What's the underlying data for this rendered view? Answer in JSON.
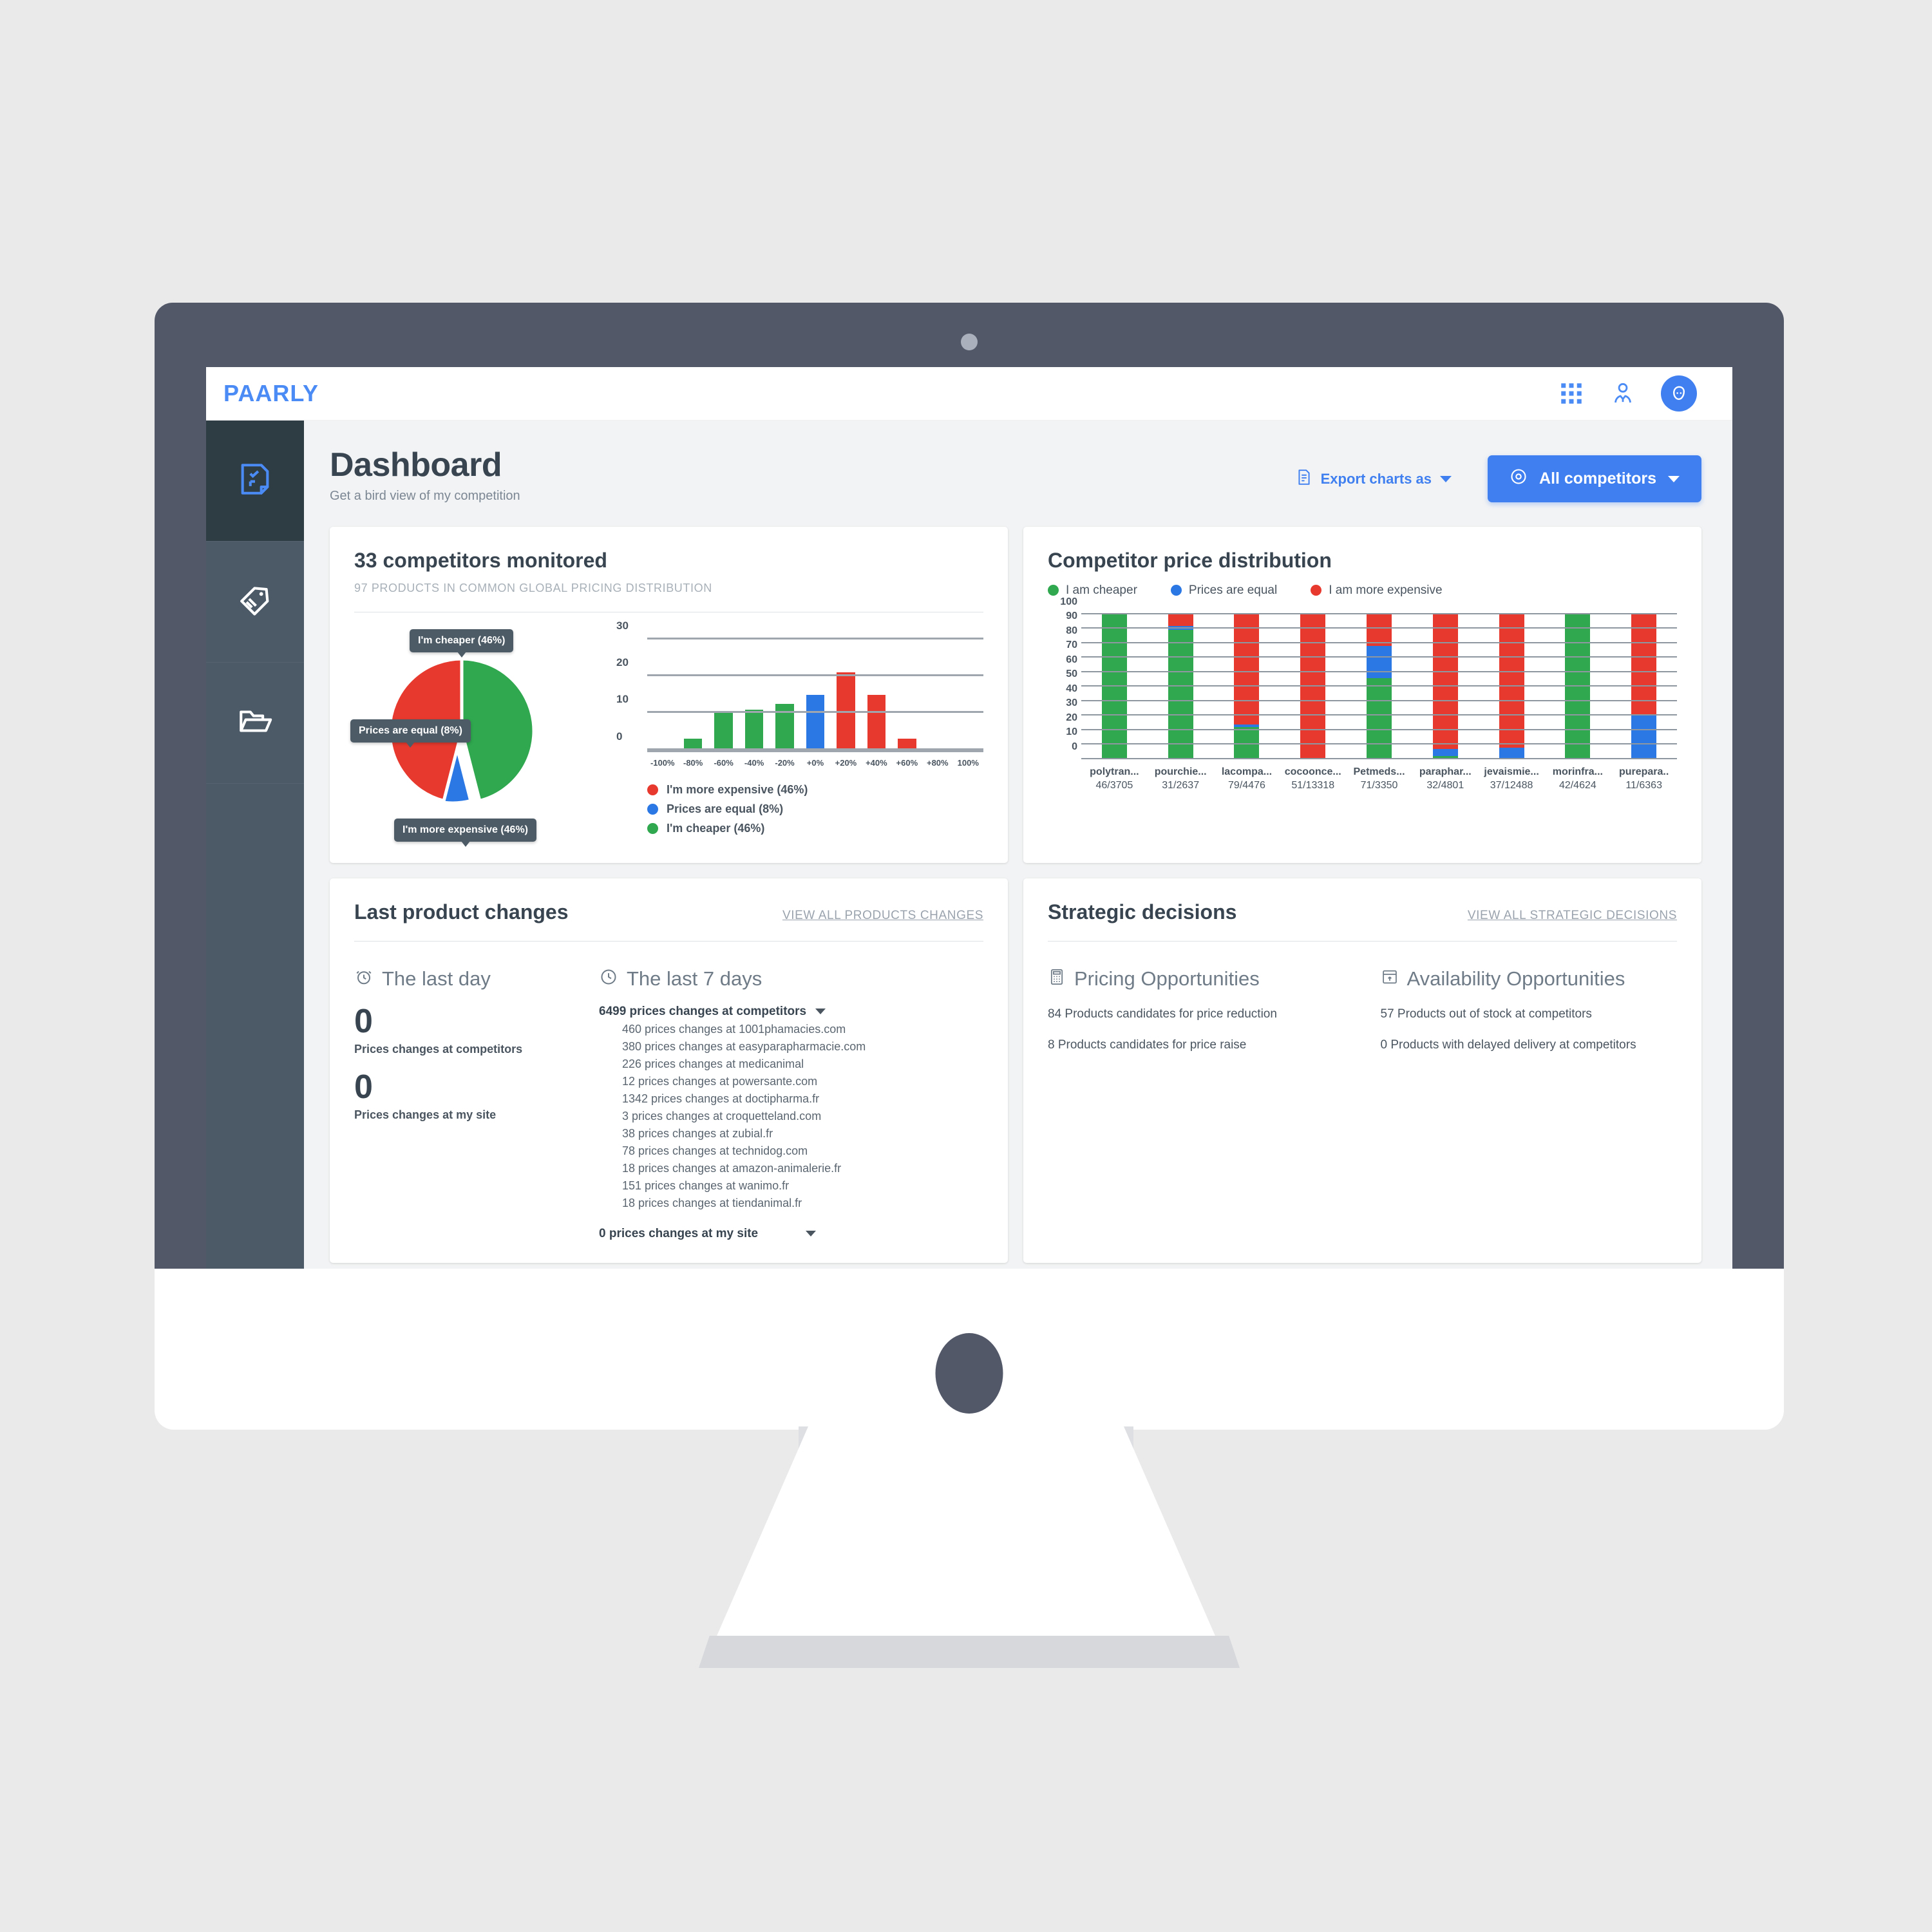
{
  "app": {
    "brand": "PAARLY",
    "topbar_icons": [
      "grid-apps-icon",
      "user-account-icon",
      "avatar-face-icon"
    ]
  },
  "sidebar": {
    "items": [
      {
        "icon": "dashboard-checklist-icon",
        "active": true
      },
      {
        "icon": "price-tag-icon",
        "active": false
      },
      {
        "icon": "folder-icon",
        "active": false
      }
    ]
  },
  "header": {
    "title": "Dashboard",
    "subtitle": "Get a bird view of my competition",
    "export_label": "Export charts as",
    "export_icon": "document-export-icon",
    "competitors_label": "All competitors",
    "competitors_icon": "eye-icon",
    "accent": "#3f7ff0"
  },
  "colors": {
    "green": "#2fa84f",
    "blue": "#2b78e4",
    "red": "#e8392e",
    "dark": "#384550",
    "muted": "#9aa3ad"
  },
  "cards": {
    "competitors": {
      "title": "33 competitors monitored",
      "subtitle": "97 PRODUCTS IN COMMON GLOBAL PRICING DISTRIBUTION"
    },
    "distribution": {
      "title": "Competitor price distribution"
    },
    "last_changes": {
      "title": "Last product changes",
      "view_all": "VIEW ALL PRODUCTS CHANGES",
      "last_day": {
        "label": "The last day",
        "icon": "alarm-clock-icon",
        "metrics": [
          {
            "value": "0",
            "caption": "Prices changes at competitors"
          },
          {
            "value": "0",
            "caption": "Prices changes at my site"
          }
        ]
      },
      "last_7_days": {
        "label": "The last 7 days",
        "icon": "clock-icon",
        "competitors_header": "6499 prices changes at competitors",
        "competitor_lines": [
          "460 prices changes at 1001phamacies.com",
          "380 prices changes at easyparapharmacie.com",
          "226 prices changes at medicanimal",
          "12 prices changes at powersante.com",
          "1342 prices changes at doctipharma.fr",
          "3 prices changes at croquetteland.com",
          "38 prices changes at zubial.fr",
          "78 prices changes at technidog.com",
          "18 prices changes at amazon-animalerie.fr",
          "151 prices changes at wanimo.fr",
          "18 prices changes at tiendanimal.fr"
        ],
        "my_site_header": "0 prices changes at my site"
      }
    },
    "strategic": {
      "title": "Strategic decisions",
      "view_all": "VIEW ALL STRATEGIC DECISIONS",
      "columns": [
        {
          "title": "Pricing Opportunities",
          "icon": "calculator-icon",
          "lines": [
            "84 Products candidates for price reduction",
            "8 Products candidates for price raise"
          ]
        },
        {
          "title": "Availability Opportunities",
          "icon": "box-upload-icon",
          "lines": [
            "57 Products out of stock at competitors",
            "0 Products with delayed delivery at competitors"
          ]
        }
      ]
    }
  },
  "chart_data": [
    {
      "type": "pie",
      "title": "Global pricing distribution",
      "labels": [
        "I'm cheaper (46%)",
        "Prices are equal (8%)",
        "I'm more expensive (46%)"
      ],
      "values": [
        46,
        8,
        46
      ],
      "colors": [
        "#2fa84f",
        "#2b78e4",
        "#e8392e"
      ],
      "legend_position": "none"
    },
    {
      "type": "bar",
      "title": "Price gap histogram",
      "categories": [
        "-100%",
        "-80%",
        "-60%",
        "-40%",
        "-20%",
        "+0%",
        "+20%",
        "+40%",
        "+60%",
        "+80%",
        "100%"
      ],
      "values": [
        0,
        3,
        10,
        11,
        12.5,
        15,
        21,
        15,
        3,
        0,
        0
      ],
      "bar_colors": [
        "#2fa84f",
        "#2fa84f",
        "#2fa84f",
        "#2fa84f",
        "#2fa84f",
        "#2b78e4",
        "#e8392e",
        "#e8392e",
        "#e8392e",
        "#e8392e",
        "#e8392e"
      ],
      "ylabel": "",
      "xlabel": "",
      "ylim": [
        0,
        30
      ],
      "yticks": [
        0,
        10,
        20,
        30
      ],
      "grid": true,
      "legend": [
        {
          "label": "I'm more expensive (46%)",
          "color": "#e8392e"
        },
        {
          "label": "Prices are equal (8%)",
          "color": "#2b78e4"
        },
        {
          "label": "I'm cheaper (46%)",
          "color": "#2fa84f"
        }
      ]
    },
    {
      "type": "bar",
      "stacked": true,
      "title": "Competitor price distribution",
      "ylim": [
        0,
        100
      ],
      "yticks": [
        0,
        10,
        20,
        30,
        40,
        50,
        60,
        70,
        80,
        90,
        100
      ],
      "grid": true,
      "legend": [
        {
          "label": "I am cheaper",
          "color": "#2fa84f"
        },
        {
          "label": "Prices are equal",
          "color": "#2b78e4"
        },
        {
          "label": "I am more expensive",
          "color": "#e8392e"
        }
      ],
      "categories": [
        "polytran...",
        "pourchie...",
        "lacompa...",
        "cocoonce...",
        "Petmeds...",
        "paraphar...",
        "jevaismie...",
        "morinfra...",
        "purepara.."
      ],
      "category_values": [
        "46/3705",
        "31/2637",
        "79/4476",
        "51/13318",
        "71/3350",
        "32/4801",
        "37/12488",
        "42/4624",
        "11/6363"
      ],
      "series": [
        {
          "name": "I am cheaper",
          "color": "#2fa84f",
          "values": [
            100,
            89,
            22,
            0,
            56,
            2,
            0,
            100,
            0
          ]
        },
        {
          "name": "Prices are equal",
          "color": "#2b78e4",
          "values": [
            0,
            3,
            2,
            0,
            22,
            5,
            8,
            0,
            30
          ]
        },
        {
          "name": "I am more expensive",
          "color": "#e8392e",
          "values": [
            0,
            8,
            76,
            100,
            22,
            93,
            92,
            0,
            70
          ]
        }
      ]
    }
  ]
}
